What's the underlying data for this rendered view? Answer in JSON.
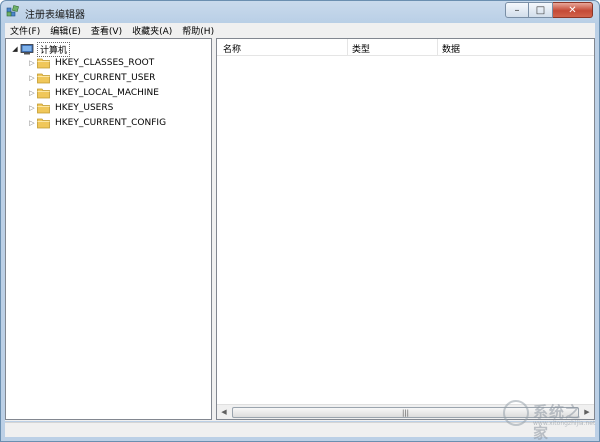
{
  "window": {
    "title": "注册表编辑器",
    "controls": {
      "minimize": "–",
      "maximize": "□",
      "close": "✕"
    }
  },
  "menu": [
    "文件(F)",
    "编辑(E)",
    "查看(V)",
    "收藏夹(A)",
    "帮助(H)"
  ],
  "tree": {
    "root": {
      "label": "计算机",
      "expanded": true,
      "icon": "computer-icon"
    },
    "keys": [
      {
        "label": "HKEY_CLASSES_ROOT",
        "icon": "folder-icon"
      },
      {
        "label": "HKEY_CURRENT_USER",
        "icon": "folder-icon"
      },
      {
        "label": "HKEY_LOCAL_MACHINE",
        "icon": "folder-icon"
      },
      {
        "label": "HKEY_USERS",
        "icon": "folder-icon"
      },
      {
        "label": "HKEY_CURRENT_CONFIG",
        "icon": "folder-icon"
      }
    ]
  },
  "list": {
    "columns": [
      "名称",
      "类型",
      "数据"
    ]
  },
  "scrollbar": {
    "left_arrow": "◀",
    "right_arrow": "▶",
    "grip": "|||"
  },
  "watermark": {
    "text": "系统之家",
    "url": "www.xitongzhijia.net"
  },
  "colors": {
    "titlebar": "#c9daec",
    "close_button": "#c44a36",
    "folder": "#f0c75a"
  }
}
